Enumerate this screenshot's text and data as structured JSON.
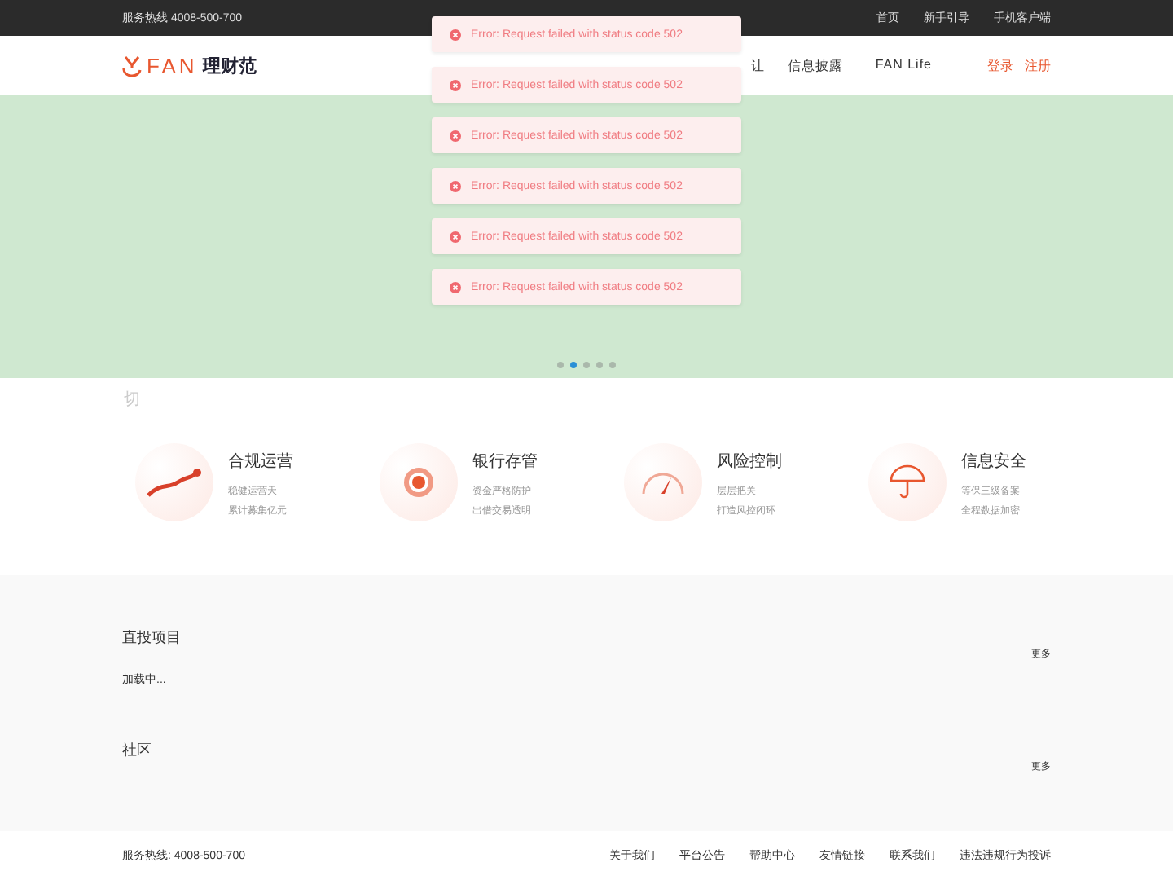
{
  "top_bar": {
    "hotline": "服务热线 4008-500-700",
    "links": [
      "首页",
      "新手引导",
      "手机客户端"
    ]
  },
  "header": {
    "logo_text": "FAN",
    "logo_sub": "理财范",
    "nav": [
      {
        "label": "让"
      },
      {
        "label": "信息披露"
      },
      {
        "label": "FAN Life"
      }
    ],
    "auth": [
      "登录",
      "注册"
    ]
  },
  "banner": {
    "dots": [
      {
        "selected": false
      },
      {
        "selected": true
      },
      {
        "selected": false
      },
      {
        "selected": false
      },
      {
        "selected": false
      }
    ]
  },
  "broken_image_text": "切",
  "features": [
    {
      "kind": "trend",
      "title": "合规运营",
      "lines": [
        "稳健运营天",
        "累计募集亿元"
      ]
    },
    {
      "kind": "bank",
      "title": "银行存管",
      "lines": [
        "资金严格防护",
        "出借交易透明"
      ]
    },
    {
      "kind": "gauge",
      "title": "风险控制",
      "lines": [
        "层层把关",
        "打造风控闭环"
      ]
    },
    {
      "kind": "umbrella",
      "title": "信息安全",
      "lines": [
        "等保三级备案",
        "全程数据加密"
      ]
    }
  ],
  "sections": [
    {
      "title": "直投项目",
      "more": "更多",
      "status": "加载中..."
    },
    {
      "title": "社区",
      "more": "更多"
    }
  ],
  "footer": {
    "hotline": "服务热线: 4008-500-700",
    "links": [
      "关于我们",
      "平台公告",
      "帮助中心",
      "友情链接",
      "联系我们",
      "违法违规行为投诉"
    ]
  },
  "toasts": [
    {
      "message": "Error: Request failed with status code 502"
    },
    {
      "message": "Error: Request failed with status code 502"
    },
    {
      "message": "Error: Request failed with status code 502"
    },
    {
      "message": "Error: Request failed with status code 502"
    },
    {
      "message": "Error: Request failed with status code 502"
    },
    {
      "message": "Error: Request failed with status code 502"
    }
  ]
}
